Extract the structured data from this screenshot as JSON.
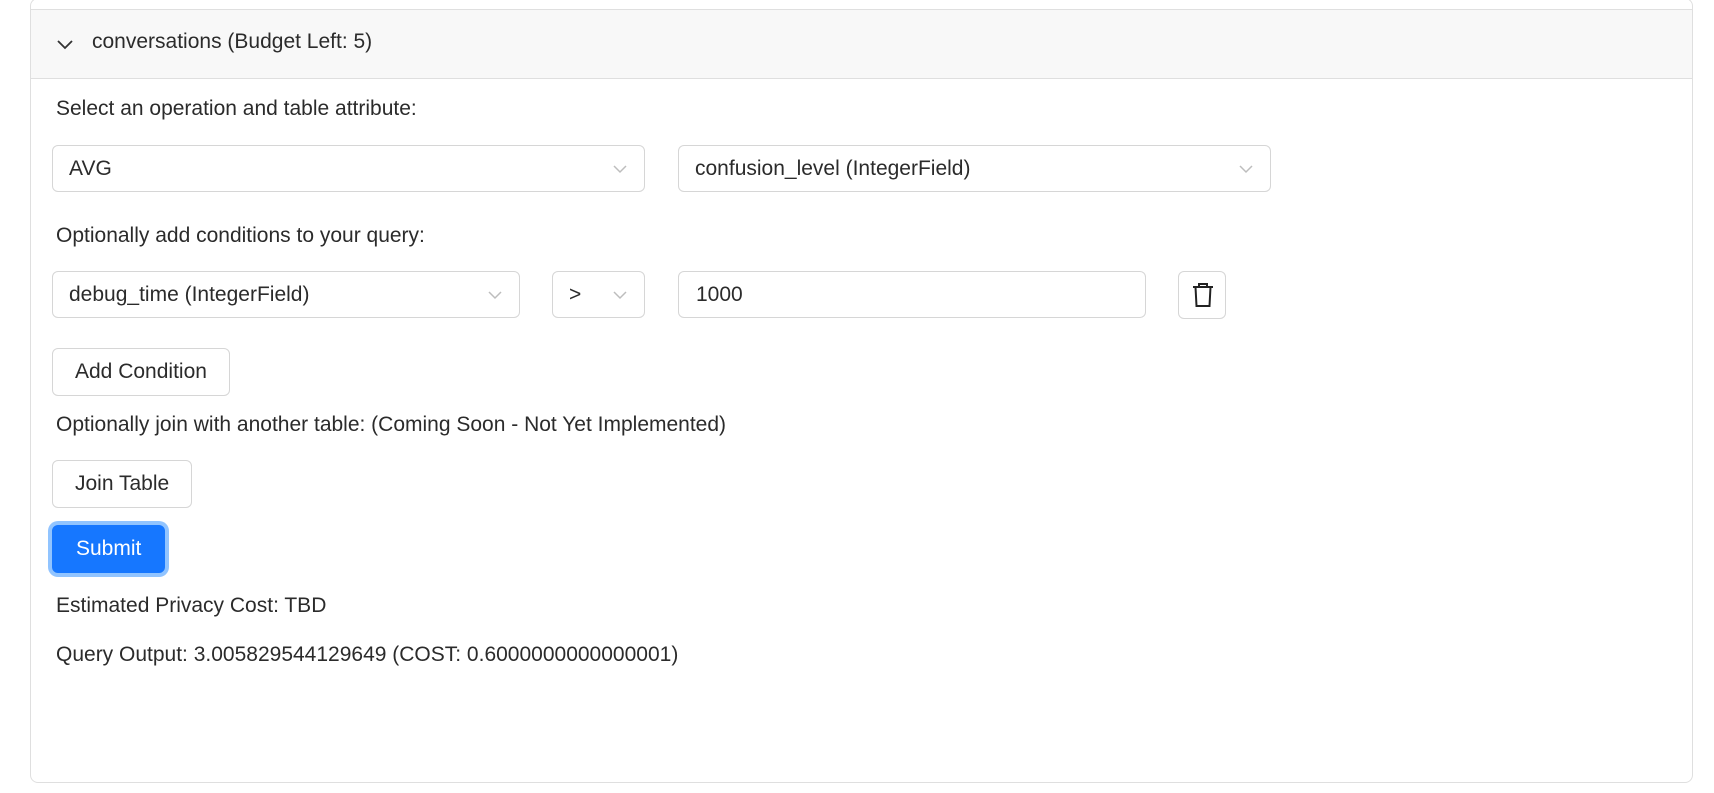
{
  "panel": {
    "header_title": "conversations (Budget Left: 5)",
    "expanded_icon": "chevron-down-icon"
  },
  "operation": {
    "label": "Select an operation and table attribute:",
    "operation_value": "AVG",
    "attribute_value": "confusion_level (IntegerField)"
  },
  "conditions": {
    "label": "Optionally add conditions to your query:",
    "field_value": "debug_time (IntegerField)",
    "operator_value": ">",
    "input_value": "1000",
    "delete_icon": "trash-icon",
    "add_label": "Add Condition"
  },
  "join": {
    "label": "Optionally join with another table: (Coming Soon - Not Yet Implemented)",
    "button_label": "Join Table"
  },
  "submit_label": "Submit",
  "results": {
    "estimated_cost": "Estimated Privacy Cost: TBD",
    "query_output": "Query Output: 3.005829544129649 (COST: 0.6000000000000001)"
  }
}
